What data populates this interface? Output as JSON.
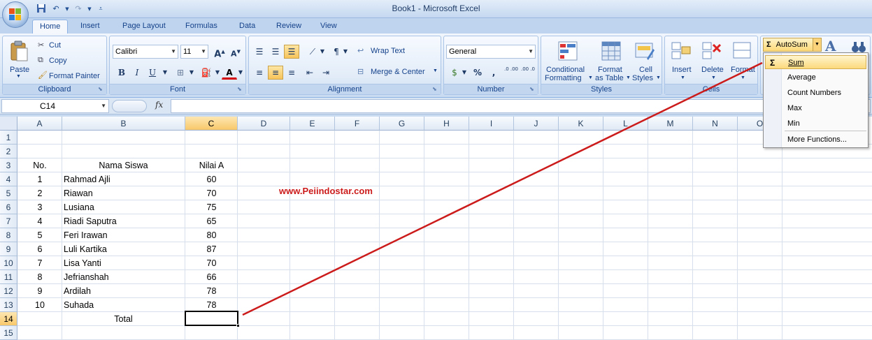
{
  "window": {
    "title": "Book1 - Microsoft Excel"
  },
  "qat": [
    "save-icon",
    "undo-icon",
    "redo-icon",
    "customize-icon"
  ],
  "tabs": [
    "Home",
    "Insert",
    "Page Layout",
    "Formulas",
    "Data",
    "Review",
    "View"
  ],
  "ribbon": {
    "clipboard": {
      "label": "Clipboard",
      "paste": "Paste",
      "cut": "Cut",
      "copy": "Copy",
      "format_painter": "Format Painter"
    },
    "font": {
      "label": "Font",
      "family": "Calibri",
      "size": "11",
      "bold": "B",
      "italic": "I",
      "underline": "U",
      "grow": "A",
      "shrink": "A",
      "color": "A"
    },
    "alignment": {
      "label": "Alignment",
      "wrap_text": "Wrap Text",
      "merge_center": "Merge & Center"
    },
    "number": {
      "label": "Number",
      "format": "General",
      "percent": "%",
      "comma": ",",
      "inc_dec": ".0 .00",
      "dec_dec": ".00 .0"
    },
    "styles": {
      "label": "Styles",
      "conditional": "Conditional",
      "conditional2": "Formatting",
      "format_table": "Format",
      "format_table2": "as Table",
      "cell_styles": "Cell",
      "cell_styles2": "Styles"
    },
    "cells": {
      "label": "Cells",
      "insert": "Insert",
      "delete": "Delete",
      "format": "Format"
    },
    "editing": {
      "autosum": "AutoSum",
      "sigma": "Σ"
    }
  },
  "formula_bar": {
    "name_box": "C14",
    "fx": "fx",
    "content": ""
  },
  "columns": [
    "A",
    "B",
    "C",
    "D",
    "E",
    "F",
    "G",
    "H",
    "I",
    "J",
    "K",
    "L",
    "M",
    "N",
    "O"
  ],
  "rows": [
    "1",
    "2",
    "3",
    "4",
    "5",
    "6",
    "7",
    "8",
    "9",
    "10",
    "11",
    "12",
    "13",
    "14",
    "15"
  ],
  "sheet": {
    "headers": {
      "no": "No.",
      "name": "Nama Siswa",
      "score": "Nilai A"
    },
    "records": [
      {
        "no": "1",
        "name": "Rahmad Ajli",
        "score": "60"
      },
      {
        "no": "2",
        "name": "Riawan",
        "score": "70"
      },
      {
        "no": "3",
        "name": "Lusiana",
        "score": "75"
      },
      {
        "no": "4",
        "name": "Riadi Saputra",
        "score": "65"
      },
      {
        "no": "5",
        "name": "Feri Irawan",
        "score": "80"
      },
      {
        "no": "6",
        "name": "Luli Kartika",
        "score": "87"
      },
      {
        "no": "7",
        "name": "Lisa Yanti",
        "score": "70"
      },
      {
        "no": "8",
        "name": "Jefrianshah",
        "score": "66"
      },
      {
        "no": "9",
        "name": "Ardilah",
        "score": "78"
      },
      {
        "no": "10",
        "name": "Suhada",
        "score": "78"
      }
    ],
    "total_label": "Total",
    "watermark": "www.Peiindostar.com"
  },
  "autosum_menu": {
    "items": [
      {
        "label": "Sum",
        "highlighted": true
      },
      {
        "label": "Average"
      },
      {
        "label": "Count Numbers"
      },
      {
        "label": "Max"
      },
      {
        "label": "Min"
      }
    ],
    "more": "More Functions..."
  },
  "colors": {
    "ribbon": "#dbe7f6",
    "accent": "#15428b",
    "highlight": "#fcd97c",
    "annotation": "#cc1b1b"
  }
}
